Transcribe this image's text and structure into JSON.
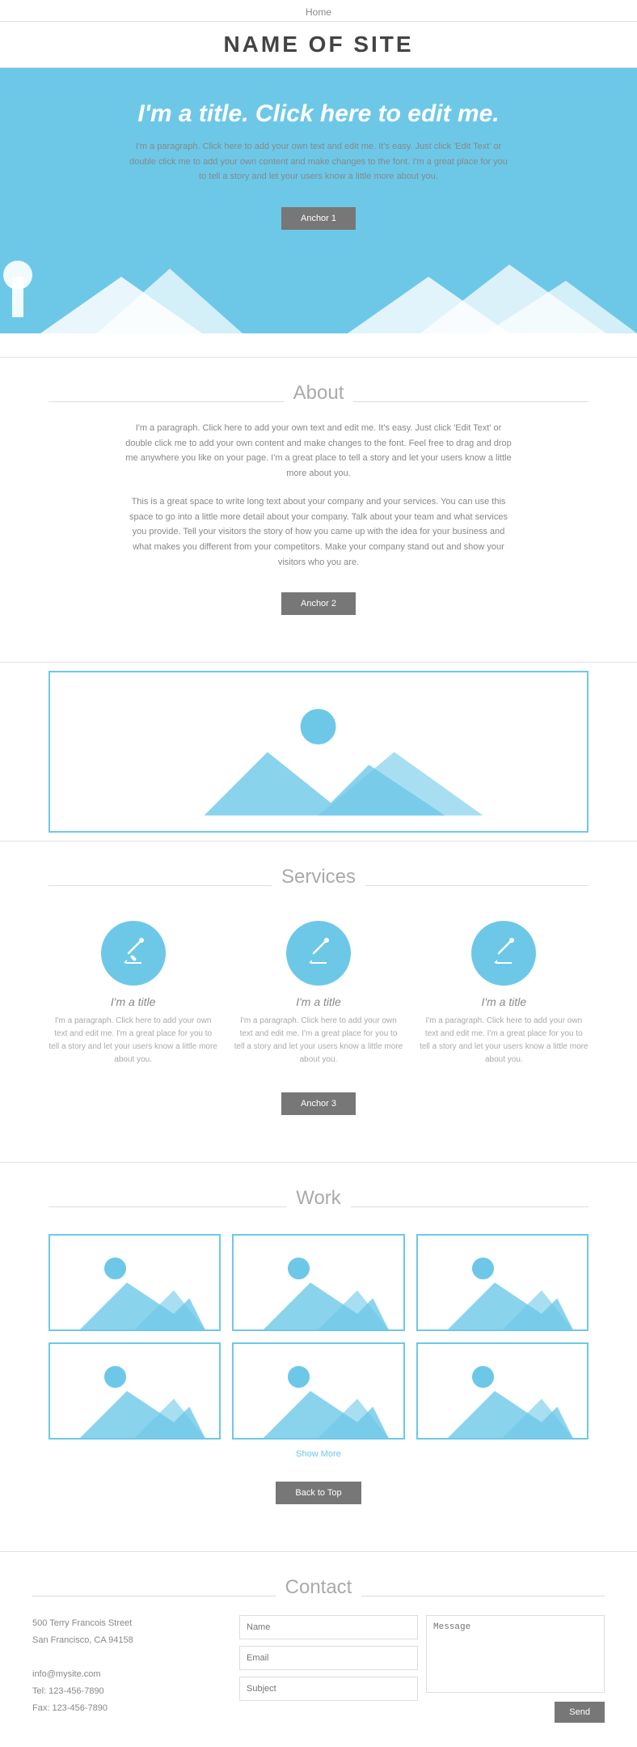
{
  "nav": {
    "home_label": "Home"
  },
  "header": {
    "site_title": "NAME OF SITE"
  },
  "hero": {
    "title": "I'm a title. Click here to edit me.",
    "paragraph": "I'm a paragraph. Click here to add your own text and edit me. It's easy. Just click 'Edit Text' or double click me to add your own content and make changes to the font. I'm a great place for you to tell a story and let your users know a little more about you.",
    "button_label": "Anchor 1"
  },
  "about": {
    "section_title": "About",
    "para1": "I'm a paragraph. Click here to add your own text and edit me. It's easy. Just click 'Edit Text' or double click me to add your own content and make changes to the font. Feel free to drag and drop me anywhere you like on your page. I'm a great place to tell a story and let your users know a little more about you.",
    "para2": "This is a great space to write long text about your company and your services. You can use this space to go into a little more detail about your company. Talk about your team and what services you provide. Tell your visitors the story of how you came up with the idea for your business and what makes you different from your competitors. Make your company stand out and show your visitors who you are.",
    "button_label": "Anchor 2"
  },
  "services": {
    "section_title": "Services",
    "items": [
      {
        "title": "I'm a title",
        "para": "I'm a paragraph. Click here to add your own text and edit me. I'm a great place for you to tell a story and let your users know a little more about you."
      },
      {
        "title": "I'm a title",
        "para": "I'm a paragraph. Click here to add your own text and edit me. I'm a great place for you to tell a story and let your users know a little more about you."
      },
      {
        "title": "I'm a title",
        "para": "I'm a paragraph. Click here to add your own text and edit me. I'm a great place for you to tell a story and let your users know a little more about you."
      }
    ],
    "button_label": "Anchor 3"
  },
  "work": {
    "section_title": "Work",
    "show_more_label": "Show More",
    "back_to_top_label": "Back to Top"
  },
  "contact": {
    "section_title": "Contact",
    "address_line1": "500 Terry Francois Street",
    "address_line2": "San Francisco, CA 94158",
    "email": "info@mysite.com",
    "tel": "Tel: 123-456-7890",
    "fax": "Fax: 123-456-7890",
    "form": {
      "name_placeholder": "Name",
      "email_placeholder": "Email",
      "subject_placeholder": "Subject",
      "message_placeholder": "Message",
      "submit_label": "Send"
    }
  }
}
